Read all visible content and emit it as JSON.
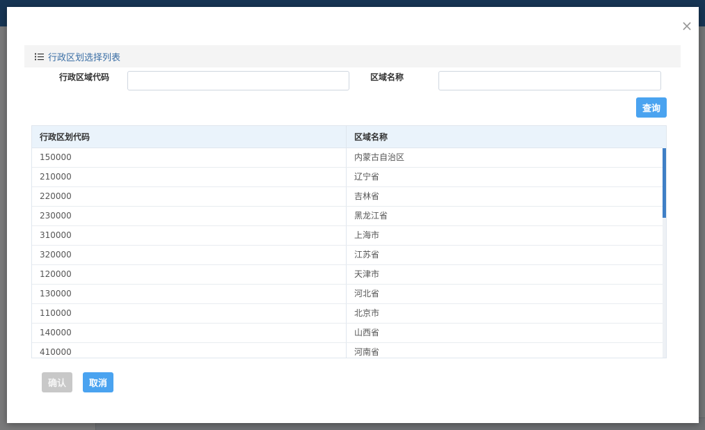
{
  "modal": {
    "close_symbol": "×",
    "panel_title": "行政区划选择列表",
    "panel_icon": "list-icon"
  },
  "search": {
    "code_label": "行政区域代码",
    "code_value": "",
    "name_label": "区域名称",
    "name_value": "",
    "query_label": "查询"
  },
  "table": {
    "columns": [
      "行政区划代码",
      "区域名称"
    ],
    "rows": [
      [
        "150000",
        "内蒙古自治区"
      ],
      [
        "210000",
        "辽宁省"
      ],
      [
        "220000",
        "吉林省"
      ],
      [
        "230000",
        "黑龙江省"
      ],
      [
        "310000",
        "上海市"
      ],
      [
        "320000",
        "江苏省"
      ],
      [
        "120000",
        "天津市"
      ],
      [
        "130000",
        "河北省"
      ],
      [
        "110000",
        "北京市"
      ],
      [
        "140000",
        "山西省"
      ],
      [
        "410000",
        "河南省"
      ]
    ]
  },
  "actions": {
    "confirm_label": "确认",
    "cancel_label": "取消"
  },
  "colors": {
    "primary": "#4aa3f0",
    "disabled": "#c8c8c8",
    "title_blue": "#3a6ea5",
    "scroll_thumb": "#3f7fc6"
  }
}
